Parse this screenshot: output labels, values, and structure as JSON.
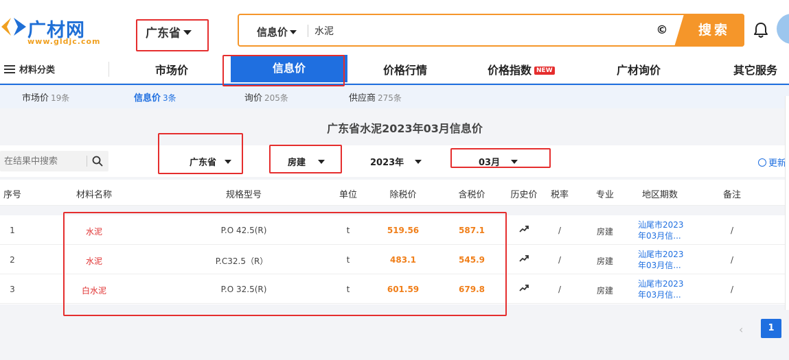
{
  "header": {
    "brand": "广材网",
    "brand_url": "www.gldjc.com",
    "province": "广东省",
    "search": {
      "type": "信息价",
      "value": "水泥",
      "button": "搜索"
    }
  },
  "nav": {
    "category": "材料分类",
    "items": [
      {
        "label": "市场价"
      },
      {
        "label": "信息价"
      },
      {
        "label": "价格行情"
      },
      {
        "label": "价格指数",
        "badge": "NEW"
      },
      {
        "label": "广材询价"
      },
      {
        "label": "其它服务"
      }
    ]
  },
  "subtabs": [
    {
      "label": "市场价",
      "count": "19条"
    },
    {
      "label": "信息价",
      "count": "3条"
    },
    {
      "label": "询价",
      "count": "205条"
    },
    {
      "label": "供应商",
      "count": "275条"
    }
  ],
  "main_title": "广东省水泥2023年03月信息价",
  "filters": {
    "search_placeholder": "在结果中搜索",
    "province": "广东省",
    "specialty": "房建",
    "year": "2023年",
    "month": "03月",
    "update": "更新"
  },
  "table": {
    "headers": [
      "序号",
      "材料名称",
      "规格型号",
      "单位",
      "除税价",
      "含税价",
      "历史价",
      "税率",
      "专业",
      "地区期数",
      "备注"
    ],
    "rows": [
      {
        "no": "1",
        "name": "水泥",
        "spec": "P.O 42.5(R)",
        "unit": "t",
        "ex_tax": "519.56",
        "in_tax": "587.1",
        "tax": "/",
        "specialty": "房建",
        "region": "汕尾市2023年03月信...",
        "note": "/"
      },
      {
        "no": "2",
        "name": "水泥",
        "spec": "P.C32.5（R）",
        "unit": "t",
        "ex_tax": "483.1",
        "in_tax": "545.9",
        "tax": "/",
        "specialty": "房建",
        "region": "汕尾市2023年03月信...",
        "note": "/"
      },
      {
        "no": "3",
        "name": "白水泥",
        "spec": "P.O 32.5(R)",
        "unit": "t",
        "ex_tax": "601.59",
        "in_tax": "679.8",
        "tax": "/",
        "specialty": "房建",
        "region": "汕尾市2023年03月信...",
        "note": "/"
      }
    ]
  },
  "pagination": {
    "prev": "‹",
    "current": "1"
  },
  "colors": {
    "brand_blue": "#1f6fe0",
    "search_orange": "#f5962a",
    "price_orange": "#f07f1a",
    "name_red": "#e03131",
    "annotation_red": "#e52d2d"
  }
}
